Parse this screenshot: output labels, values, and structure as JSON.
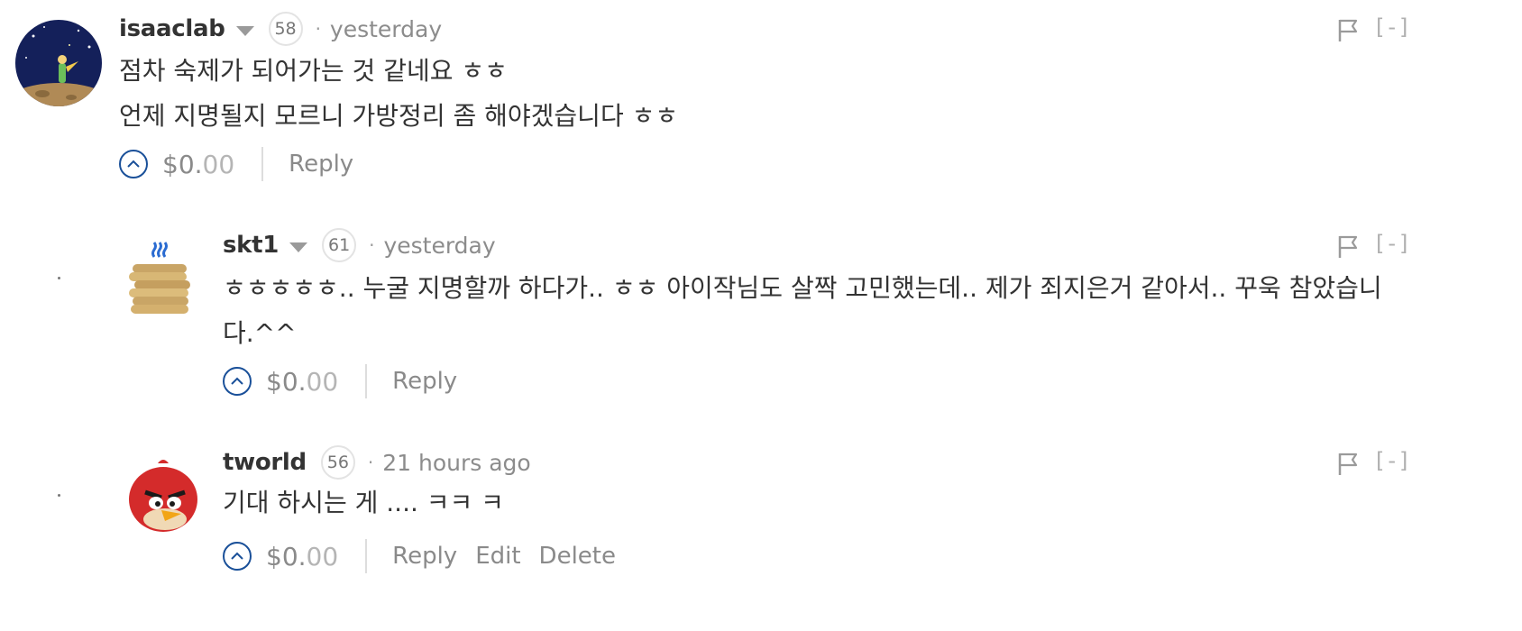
{
  "comments": [
    {
      "author": "isaaclab",
      "reputation": "58",
      "separator": "·",
      "time": "yesterday",
      "avatar_icon": "little-prince-avatar-icon",
      "lines": [
        "점차 숙제가 되어가는 것 같네요 ㅎㅎ",
        "언제 지명될지 모르니 가방정리 좀 해야겠습니다 ㅎㅎ"
      ],
      "payout_dollars": "$0.",
      "payout_cents": "00",
      "actions": [
        "Reply"
      ],
      "collapse_label": "[-]"
    },
    {
      "author": "skt1",
      "reputation": "61",
      "separator": "·",
      "time": "yesterday",
      "avatar_icon": "coin-stack-avatar-icon",
      "lines": [
        "ㅎㅎㅎㅎㅎ.. 누굴 지명할까 하다가.. ㅎㅎ 아이작님도 살짝 고민했는데.. 제가 죄지은거 같아서.. 꾸욱 참았습니",
        "다.^^"
      ],
      "payout_dollars": "$0.",
      "payout_cents": "00",
      "actions": [
        "Reply"
      ],
      "collapse_label": "[-]"
    },
    {
      "author": "tworld",
      "reputation": "56",
      "separator": "·",
      "time": "21 hours ago",
      "avatar_icon": "red-bird-avatar-icon",
      "lines": [
        "기대 하시는 게 .... ㅋㅋ ㅋ"
      ],
      "payout_dollars": "$0.",
      "payout_cents": "00",
      "actions": [
        "Reply",
        "Edit",
        "Delete"
      ],
      "collapse_label": "[-]"
    }
  ]
}
